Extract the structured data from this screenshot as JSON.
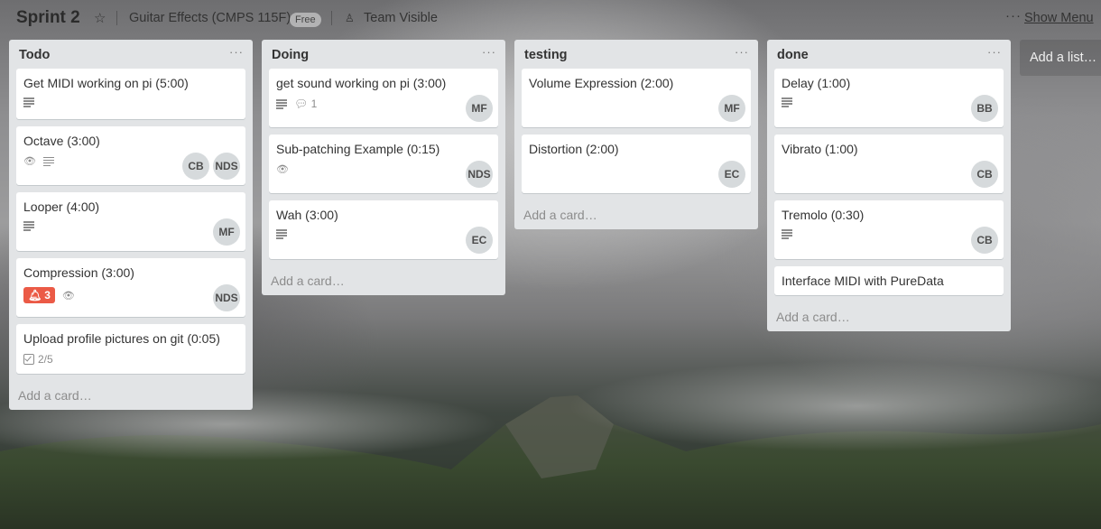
{
  "header": {
    "board_title": "Sprint 2",
    "team_name": "Guitar Effects (CMPS 115F)",
    "plan_badge": "Free",
    "visibility": "Team Visible",
    "show_menu": "Show Menu"
  },
  "lists": [
    {
      "title": "Todo",
      "add_card": "Add a card…",
      "cards": [
        {
          "title": "Get MIDI working on pi (5:00)",
          "members": []
        },
        {
          "title": "Octave (3:00)",
          "members": [
            "CB",
            "NDS"
          ]
        },
        {
          "title": "Looper (4:00)",
          "members": [
            "MF"
          ]
        },
        {
          "title": "Compression (3:00)",
          "due_count": "3",
          "members": [
            "NDS"
          ]
        },
        {
          "title": "Upload profile pictures on git (0:05)",
          "checklist": "2/5",
          "members": []
        }
      ]
    },
    {
      "title": "Doing",
      "add_card": "Add a card…",
      "cards": [
        {
          "title": "get sound working on pi (3:00)",
          "comments": "1",
          "members": [
            "MF"
          ]
        },
        {
          "title": "Sub-patching Example (0:15)",
          "members": [
            "NDS"
          ]
        },
        {
          "title": "Wah (3:00)",
          "members": [
            "EC"
          ]
        }
      ]
    },
    {
      "title": "testing",
      "add_card": "Add a card…",
      "cards": [
        {
          "title": "Volume Expression (2:00)",
          "members": [
            "MF"
          ]
        },
        {
          "title": "Distortion (2:00)",
          "members": [
            "EC"
          ]
        }
      ]
    },
    {
      "title": "done",
      "add_card": "Add a card…",
      "cards": [
        {
          "title": "Delay (1:00)",
          "members": [
            "BB"
          ]
        },
        {
          "title": "Vibrato (1:00)",
          "members": [
            "CB"
          ]
        },
        {
          "title": "Tremolo (0:30)",
          "members": [
            "CB"
          ]
        },
        {
          "title": "Interface MIDI with PureData",
          "members": []
        }
      ]
    }
  ],
  "add_list": "Add a list…",
  "icons": {
    "star": "star-icon",
    "visibility": "team-icon",
    "description": "description-icon",
    "watch": "eye-icon",
    "comment": "comment-icon",
    "due": "bell-icon",
    "checklist": "checklist-icon"
  }
}
